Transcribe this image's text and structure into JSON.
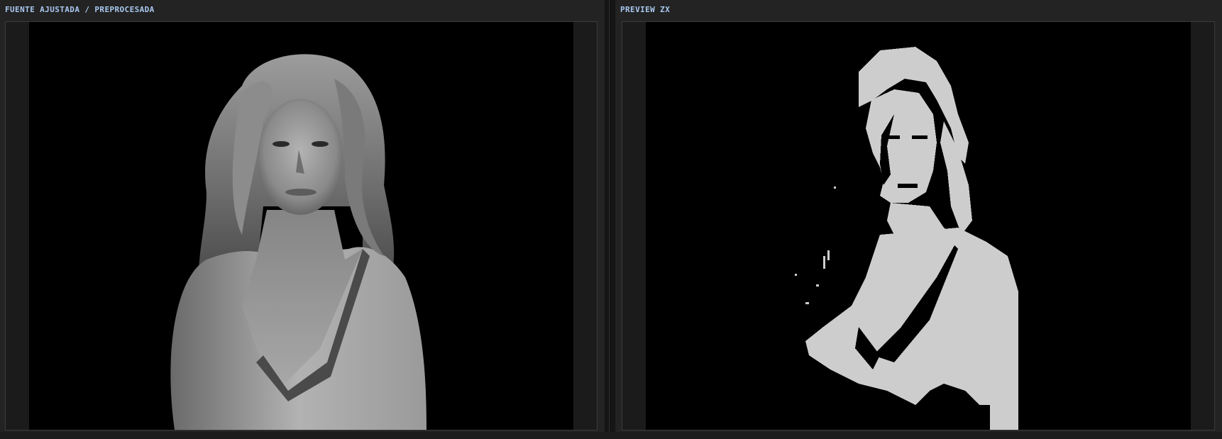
{
  "panels": {
    "source": {
      "title": "FUENTE AJUSTADA / PREPROCESADA",
      "image_icon": "grayscale-portrait-image"
    },
    "preview": {
      "title": "PREVIEW ZX",
      "image_icon": "dithered-zx-portrait-image"
    }
  },
  "colors": {
    "title": "#a9c8ef",
    "background": "#222222",
    "canvas": "#000000",
    "zx_ink": "#cdcdcd"
  }
}
